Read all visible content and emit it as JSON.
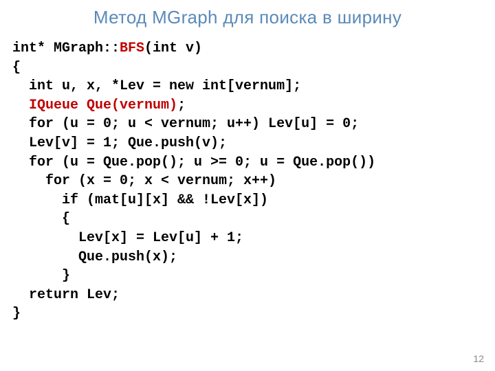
{
  "title": "Метод MGraph для поиска в ширину",
  "code": {
    "l1a": "int* MGraph::",
    "l1b": "BFS",
    "l1c": "(int v)",
    "l2": "{",
    "l3": "  int u, x, *Lev = new int[vernum];",
    "l4a": "  ",
    "l4b": "IQueue Que(vernum)",
    "l4c": ";",
    "l5": "  for (u = 0; u < vernum; u++) Lev[u] = 0;",
    "l6": "  Lev[v] = 1; Que.push(v);",
    "l7": "  for (u = Que.pop(); u >= 0; u = Que.pop())",
    "l8": "    for (x = 0; x < vernum; x++)",
    "l9": "      if (mat[u][x] && !Lev[x])",
    "l10": "      {",
    "l11": "        Lev[x] = Lev[u] + 1;",
    "l12": "        Que.push(x);",
    "l13": "      }",
    "l14": "  return Lev;",
    "l15": "}"
  },
  "page_number": "12"
}
